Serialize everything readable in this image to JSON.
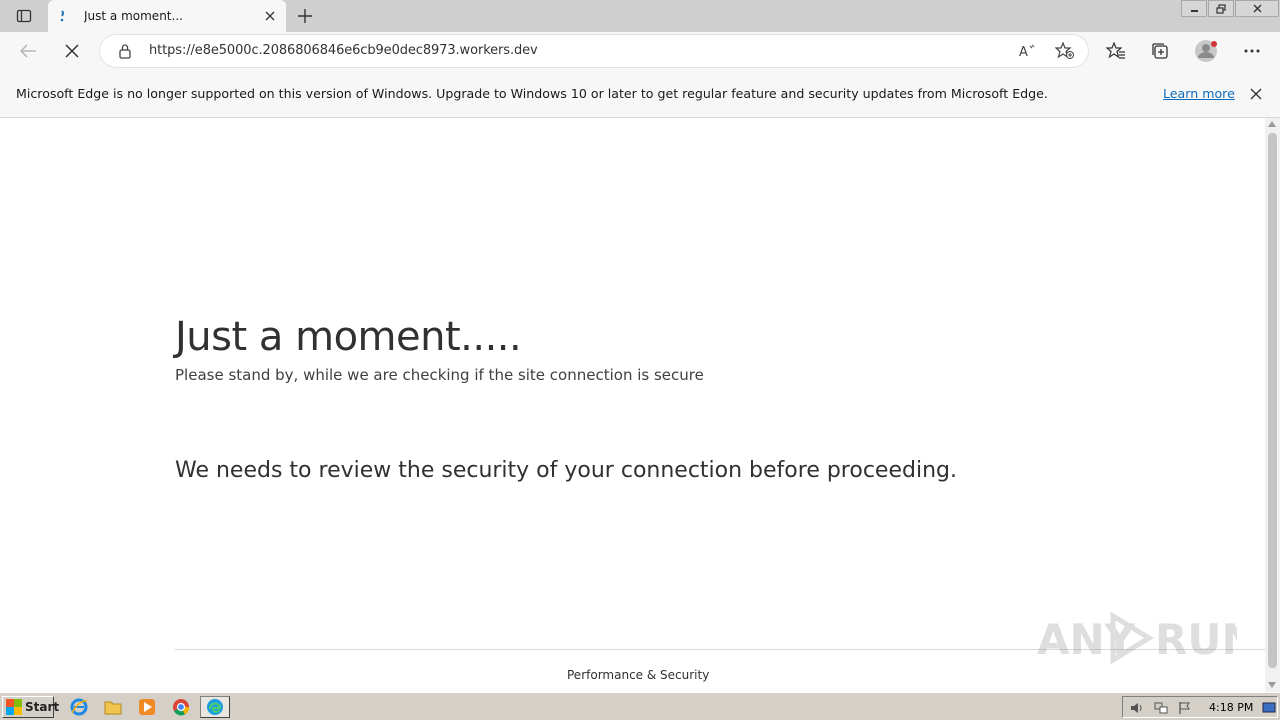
{
  "browser": {
    "tab": {
      "title": "Just a moment..."
    },
    "address": {
      "url": "https://e8e5000c.2086806846e6cb9e0dec8973.workers.dev"
    },
    "infobar": {
      "message": "Microsoft Edge is no longer supported on this version of Windows. Upgrade to Windows 10 or later to get regular feature and security updates from Microsoft Edge.",
      "link_label": "Learn more"
    }
  },
  "page": {
    "title": "Just a moment.....",
    "subtitle": "Please stand by, while we are checking if the site connection is secure",
    "message": "We needs to review the security of your connection before proceeding.",
    "footer": "Performance & Security"
  },
  "watermark": {
    "text": "ANY RUN"
  },
  "taskbar": {
    "start_label": "Start",
    "clock": "4:18 PM",
    "apps": [
      "internet-explorer-icon",
      "folder-icon",
      "media-player-icon",
      "chrome-icon",
      "edge-icon"
    ]
  },
  "colors": {
    "link": "#0f6cbd",
    "tab_strip": "#cfcfcf",
    "toolbar": "#f7f7f7",
    "taskbar": "#d4d0c8"
  }
}
